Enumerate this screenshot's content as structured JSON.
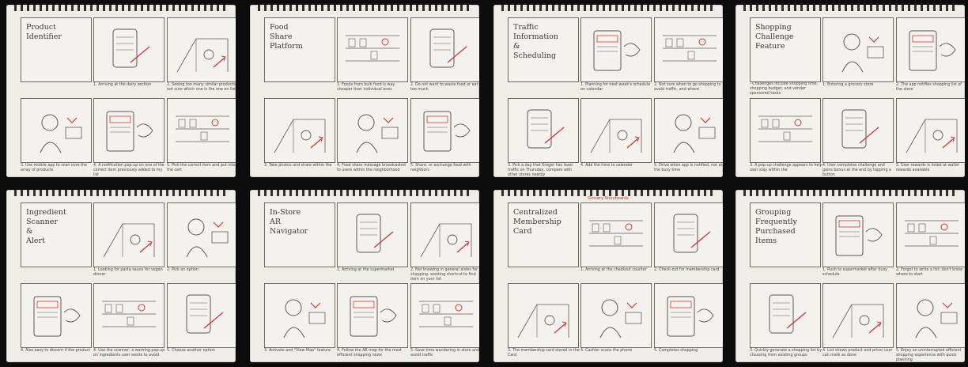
{
  "storyboards": [
    {
      "title": "Product\nIdentifier",
      "captions": [
        "1. Arriving at the dairy section",
        "2. Seeing too many similar products, not sure which one is the one on list",
        "3. Use mobile app to scan over the array of products",
        "4. A notification pop-up on one of the correct item previously added to my list",
        "5. Pick the correct item and put into the cart"
      ]
    },
    {
      "title": "Food\nShare\nPlatform",
      "captions": [
        "1. Foods from bulk food is way cheaper than individual ones",
        "2. Do not want to waste food or eat too much",
        "3. Take photos and share within the",
        "4. Food share message broadcasted to users within the neighborhood",
        "5. Share, or exchange food with neighbors"
      ]
    },
    {
      "title": "Traffic\nInformation\n&\nScheduling",
      "captions": [
        "1. Planning for next week's schedule on calendar",
        "2. Not sure when to go shopping to avoid traffic, and where",
        "3. Pick a day that Kroger has least traffic on Thursday, compare with other stores nearby",
        "4. Add the time to calendar",
        "5. Drive when app is notified, not at the busy time"
      ]
    },
    {
      "title": "Shopping\nChallenge\nFeature",
      "subtitle": "- Challenges include shopping time, shopping budget, and vendor sponsored tasks.",
      "captions": [
        "1. Entering a grocery store",
        "2. The app notifies shopping list of the store",
        "3. A pop-up challenge appears to help user stay within the",
        "4. User completes challenge and gains bonus at the end by tapping a button",
        "5. User rewards is listed at wallet rewards available"
      ]
    },
    {
      "title": "Ingredient\nScanner\n&\nAlert",
      "captions": [
        "1. Looking for pasta sauce for vegan dinner",
        "2. Pick an option",
        "4. Also easy to discern if the product",
        "4. Use the scanner; a warning pop-up on ingredients user wants to avoid",
        "5. Choose another option"
      ]
    },
    {
      "title": "In-Store\nAR\nNavigator",
      "captions": [
        "1. Arriving at the supermarket",
        "2. Not knowing in general aisles for shopping, wanting shortcut to find item on your list",
        "3. Activate and \"View Map\" feature",
        "4. Follow the AR map for the most efficient shopping route",
        "5. Save time wandering in store and avoid traffic"
      ]
    },
    {
      "title": "Centralized\nMembership\nCard",
      "note": "Grocery Storyboards",
      "captions": [
        "1. Arriving at the checkout counter",
        "2. Check-out for membership card",
        "3. The membership card stored in the Card",
        "4. Cashier scans the phone",
        "5. Completes shopping"
      ]
    },
    {
      "title": "Grouping\nFrequently\nPurchased\nItems",
      "captions": [
        "1. Rush to supermarket after busy schedule",
        "2. Forgot to write a list; don't know where to start",
        "3. Quickly generate a shopping list by choosing from existing groups",
        "4. List shows product and price; user can mark as done",
        "5. Enjoy an uninterrupted efficient shopping experience with quick planning"
      ]
    }
  ],
  "colors": {
    "pencil": "#5e5955",
    "redpen": "#d23a3a",
    "paper": "#efede8"
  }
}
